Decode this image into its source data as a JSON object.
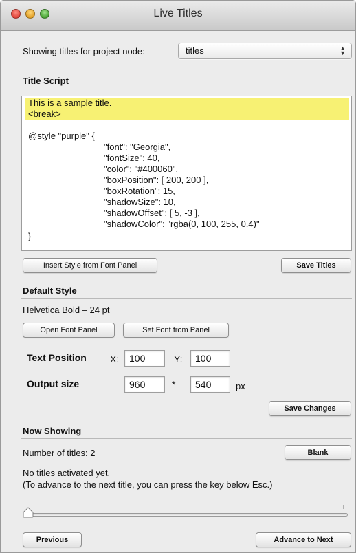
{
  "window": {
    "title": "Live Titles"
  },
  "project": {
    "label": "Showing titles for project node:",
    "selected": "titles"
  },
  "title_script": {
    "heading": "Title Script",
    "lines": [
      "This is a sample title.",
      "<break>",
      "",
      "@style \"purple\" {",
      "\"font\": \"Georgia\",",
      "\"fontSize\": 40,",
      "\"color\": \"#400060\",",
      "\"boxPosition\": [ 200, 200 ],",
      "\"boxRotation\": 15,",
      "\"shadowSize\": 10,",
      "\"shadowOffset\": [ 5, -3 ],",
      "\"shadowColor\": \"rgba(0, 100, 255, 0.4)\"",
      "}"
    ],
    "highlight_color": "#f7f173",
    "insert_style_button": "Insert Style from Font Panel",
    "save_titles_button": "Save Titles"
  },
  "default_style": {
    "heading": "Default Style",
    "font_description": "Helvetica Bold – 24 pt",
    "open_font_panel_button": "Open Font Panel",
    "set_font_button": "Set Font from Panel",
    "text_position_label": "Text Position",
    "x_label": "X:",
    "x_value": "100",
    "y_label": "Y:",
    "y_value": "100",
    "output_size_label": "Output size",
    "width_value": "960",
    "times_symbol": "*",
    "height_value": "540",
    "unit": "px",
    "save_changes_button": "Save Changes"
  },
  "now_showing": {
    "heading": "Now Showing",
    "count_text": "Number of titles: 2",
    "blank_button": "Blank",
    "status_line_1": "No titles activated yet.",
    "status_line_2": "(To advance to the next title, you can press the key below Esc.)",
    "slider_position": 0,
    "previous_button": "Previous",
    "advance_button": "Advance to Next"
  }
}
